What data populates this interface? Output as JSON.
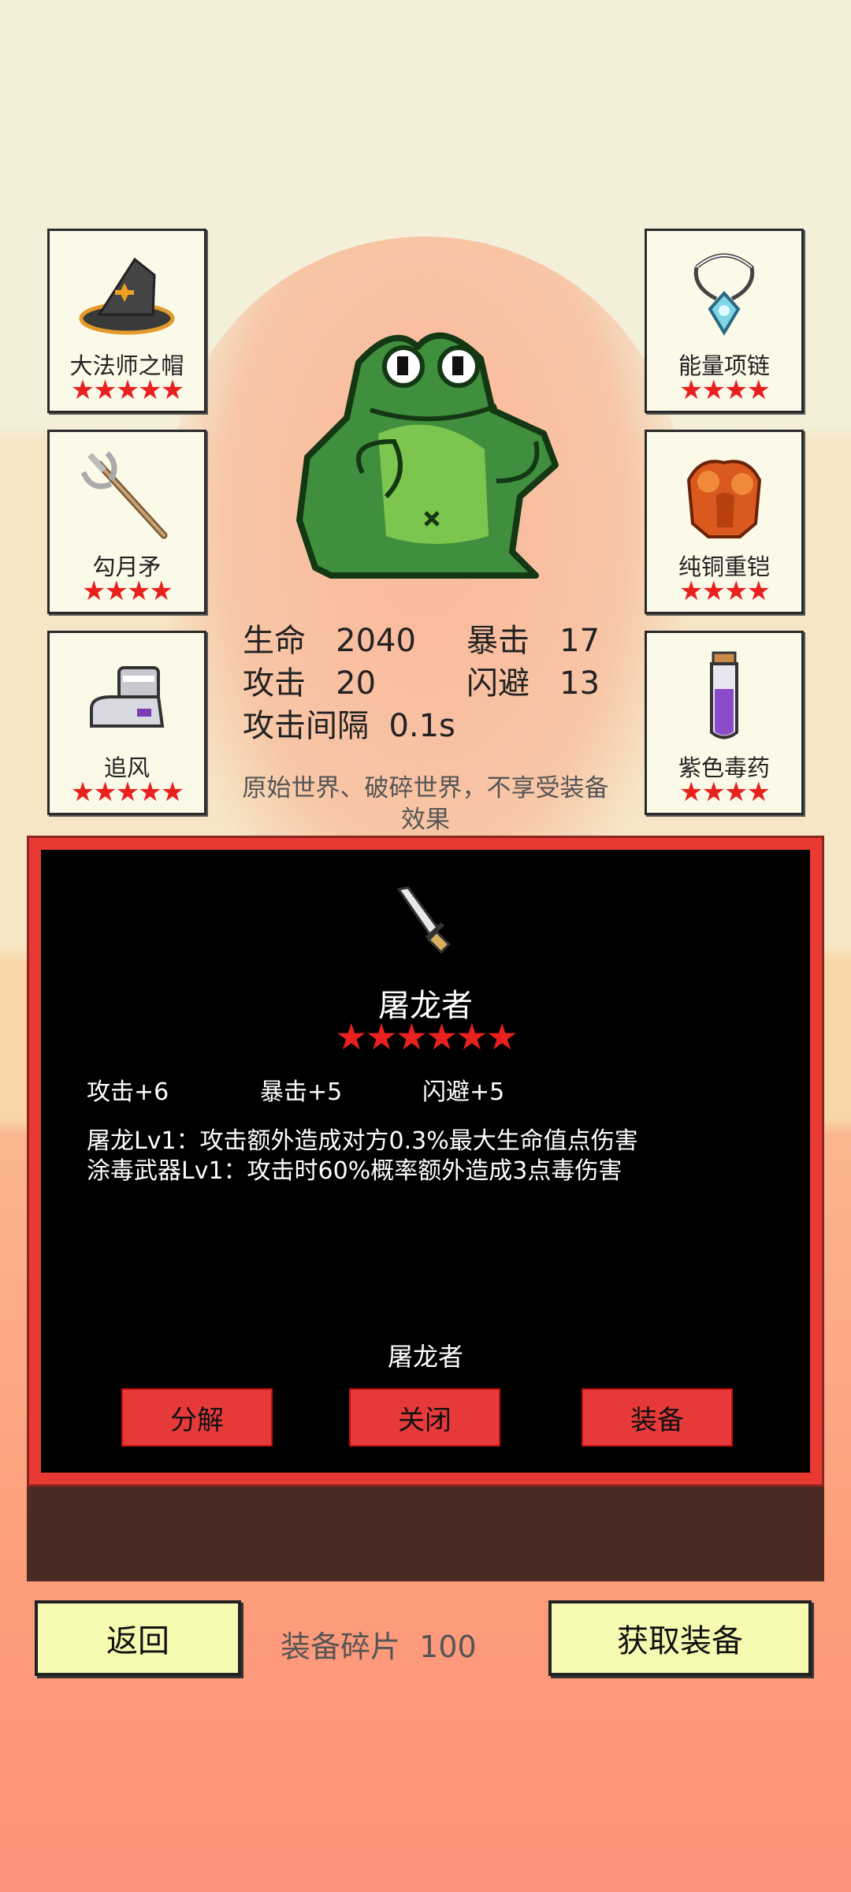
{
  "slots": [
    {
      "name": "大法师之帽",
      "stars": "★★★★★",
      "icon": "wizard-hat-icon"
    },
    {
      "name": "勾月矛",
      "stars": "★★★★",
      "icon": "crescent-spear-icon"
    },
    {
      "name": "追风",
      "stars": "★★★★★",
      "icon": "boots-icon"
    },
    {
      "name": "能量项链",
      "stars": "★★★★",
      "icon": "necklace-icon"
    },
    {
      "name": "纯铜重铠",
      "stars": "★★★★",
      "icon": "armor-icon"
    },
    {
      "name": "紫色毒药",
      "stars": "★★★★",
      "icon": "poison-potion-icon"
    }
  ],
  "stats": {
    "hp_label": "生命",
    "hp_value": "2040",
    "crit_label": "暴击",
    "crit_value": "17",
    "atk_label": "攻击",
    "atk_value": "20",
    "dodge_label": "闪避",
    "dodge_value": "13",
    "interval_label": "攻击间隔",
    "interval_value": "0.1s"
  },
  "notice": "原始世界、破碎世界，不享受装备效果",
  "item": {
    "icon": "dagger-icon",
    "name": "屠龙者",
    "stars": "★★★★★★",
    "bonuses": [
      "攻击+6",
      "暴击+5",
      "闪避+5"
    ],
    "skills": [
      "屠龙Lv1：攻击额外造成对方0.3%最大生命值点伤害",
      "涂毒武器Lv1：攻击时60%概率额外造成3点毒伤害"
    ],
    "subtitle": "屠龙者"
  },
  "buttons": {
    "dismantle": "分解",
    "close": "关闭",
    "equip": "装备",
    "back": "返回",
    "get": "获取装备"
  },
  "fragments": {
    "label": "装备碎片",
    "value": "100"
  },
  "colors": {
    "star": "#e8201e",
    "panel_border": "#e83a32",
    "button_yellow": "#f5fab0"
  }
}
